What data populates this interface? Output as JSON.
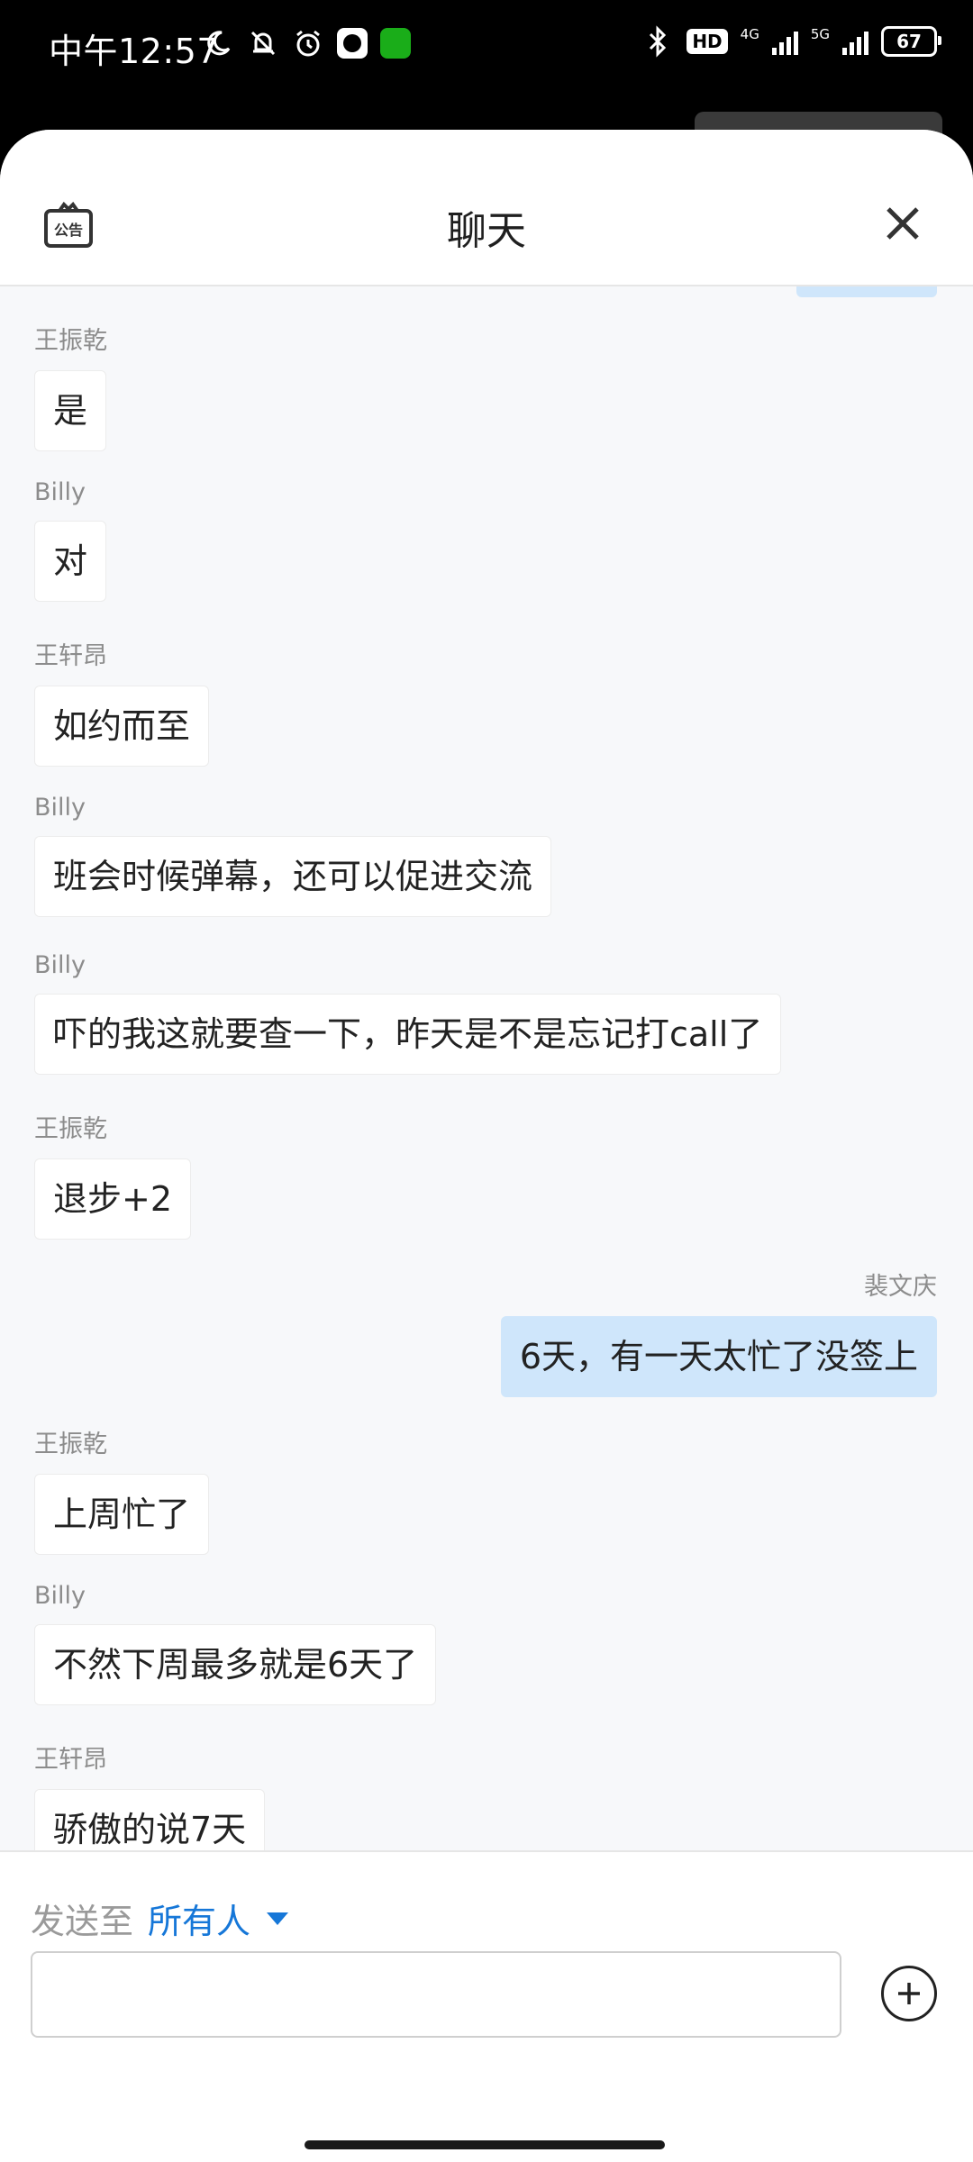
{
  "status_bar": {
    "time": "中午12:57",
    "network_1": "4G",
    "network_2": "5G",
    "hd_label": "HD",
    "battery": "67"
  },
  "header": {
    "title": "聊天",
    "notice_icon_label": "公告"
  },
  "messages": [
    {
      "sender": "王振乾",
      "text": "是",
      "self": false
    },
    {
      "sender": "Billy",
      "text": "对",
      "self": false
    },
    {
      "sender": "王轩昂",
      "text": "如约而至",
      "self": false
    },
    {
      "sender": "Billy",
      "text": "班会时候弹幕，还可以促进交流",
      "self": false
    },
    {
      "sender": "Billy",
      "text": "吓的我这就要查一下，昨天是不是忘记打call了",
      "self": false
    },
    {
      "sender": "王振乾",
      "text": "退步+2",
      "self": false
    },
    {
      "sender": "裴文庆",
      "text": "6天，有一天太忙了没签上",
      "self": true
    },
    {
      "sender": "王振乾",
      "text": "上周忙了",
      "self": false
    },
    {
      "sender": "Billy",
      "text": "不然下周最多就是6天了",
      "self": false
    },
    {
      "sender": "王轩昂",
      "text": "骄傲的说7天",
      "self": false
    }
  ],
  "footer": {
    "send_to_label": "发送至",
    "send_to_target": "所有人",
    "input_placeholder": ""
  },
  "colors": {
    "accent": "#1677d8",
    "self_bubble": "#cfe6fb",
    "wechat_green": "#1aad19"
  }
}
